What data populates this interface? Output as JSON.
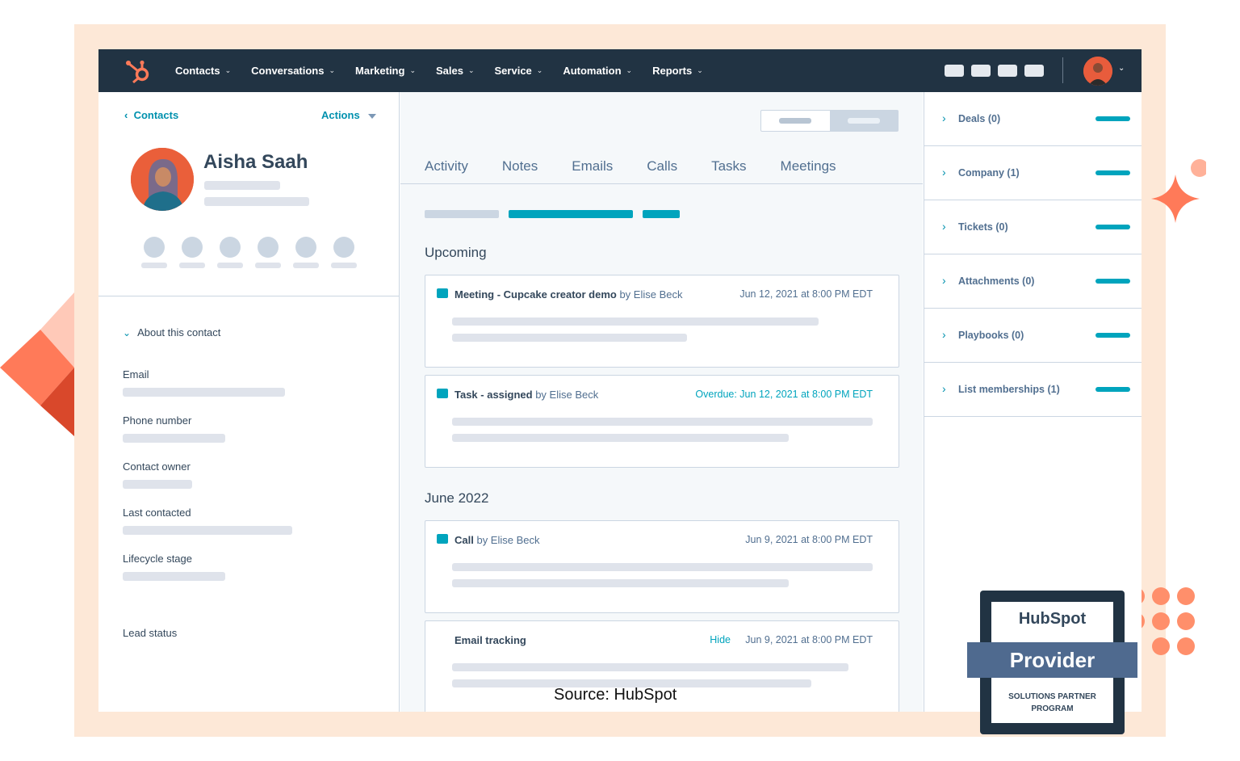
{
  "nav": {
    "menu": [
      {
        "label": "Contacts"
      },
      {
        "label": "Conversations"
      },
      {
        "label": "Marketing"
      },
      {
        "label": "Sales"
      },
      {
        "label": "Service"
      },
      {
        "label": "Automation"
      },
      {
        "label": "Reports"
      }
    ]
  },
  "contact": {
    "back_label": "Contacts",
    "actions_label": "Actions",
    "name": "Aisha Saah",
    "about_label": "About this contact",
    "fields": [
      {
        "label": "Email"
      },
      {
        "label": "Phone number"
      },
      {
        "label": "Contact owner"
      },
      {
        "label": "Last contacted"
      },
      {
        "label": "Lifecycle stage"
      },
      {
        "label": "Lead status"
      }
    ]
  },
  "timeline": {
    "tabs": [
      "Activity",
      "Notes",
      "Emails",
      "Calls",
      "Tasks",
      "Meetings"
    ],
    "sections": [
      "Upcoming",
      "June 2022"
    ],
    "cards": [
      {
        "title": "Meeting - Cupcake creator demo",
        "by": "by Elise Beck",
        "date": "Jun 12, 2021 at 8:00 PM EDT"
      },
      {
        "title": "Task - assigned",
        "by": "by Elise Beck",
        "date": "Overdue: Jun 12, 2021 at 8:00 PM EDT"
      },
      {
        "title": "Call",
        "by": "by Elise Beck",
        "date": "Jun 9, 2021 at 8:00 PM EDT"
      },
      {
        "title": "Email tracking",
        "by": "",
        "hide": "Hide",
        "date": "Jun 9, 2021 at 8:00 PM EDT"
      }
    ]
  },
  "sidebar": {
    "items": [
      {
        "label": "Deals (0)"
      },
      {
        "label": "Company (1)"
      },
      {
        "label": "Tickets (0)"
      },
      {
        "label": "Attachments (0)"
      },
      {
        "label": "Playbooks (0)"
      },
      {
        "label": "List memberships (1)"
      }
    ]
  },
  "source": "Source: HubSpot",
  "badge": {
    "brand": "HubSpot",
    "tier": "Provider",
    "program": "SOLUTIONS PARTNER PROGRAM"
  },
  "colors": {
    "nav_bg": "#213343",
    "accent": "#00a4bd",
    "brand_orange": "#ff5c35",
    "frame_bg": "#fde8d7"
  }
}
